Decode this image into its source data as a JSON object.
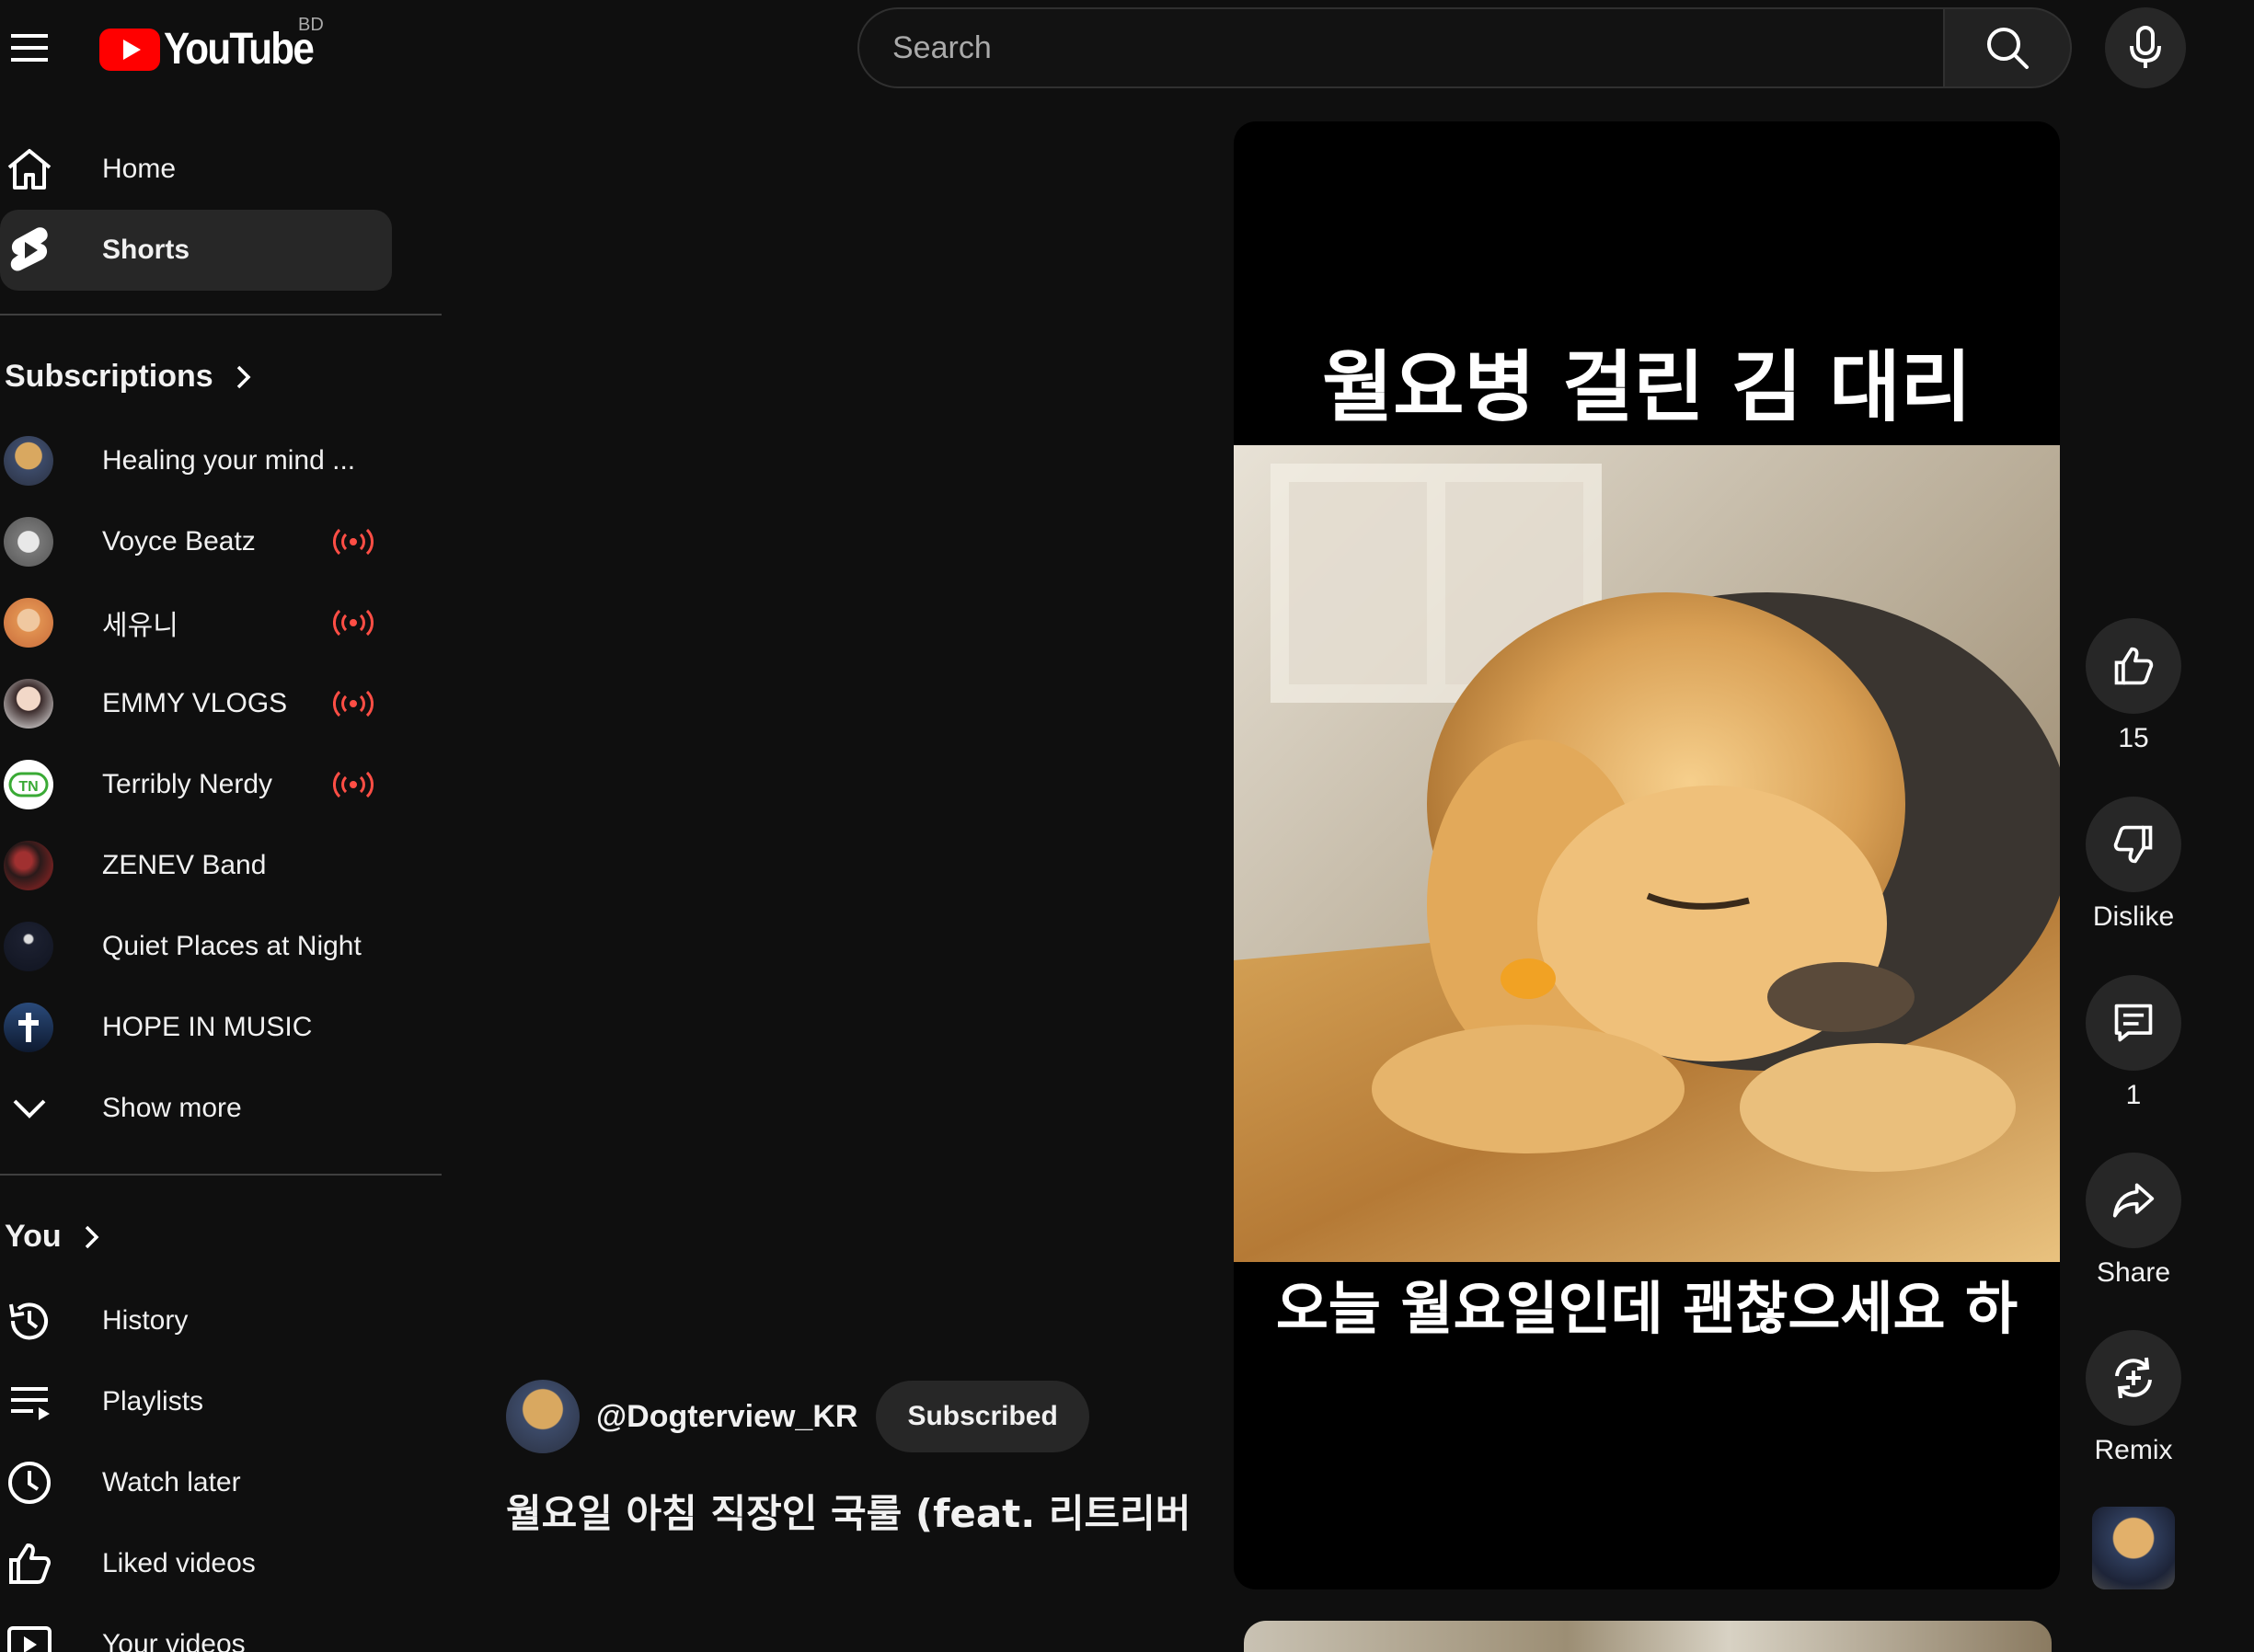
{
  "header": {
    "logo_text": "YouTube",
    "country_code": "BD",
    "search_placeholder": "Search"
  },
  "sidebar": {
    "primary": [
      {
        "label": "Home"
      },
      {
        "label": "Shorts"
      }
    ],
    "subscriptions_title": "Subscriptions",
    "subscriptions": [
      {
        "label": "Healing your mind ...",
        "live": false
      },
      {
        "label": "Voyce Beatz",
        "live": true
      },
      {
        "label": "세유니",
        "live": true
      },
      {
        "label": "EMMY VLOGS",
        "live": true
      },
      {
        "label": "Terribly Nerdy",
        "live": true
      },
      {
        "label": "ZENEV Band",
        "live": false
      },
      {
        "label": "Quiet Places at Night",
        "live": false
      },
      {
        "label": "HOPE IN MUSIC",
        "live": false
      }
    ],
    "show_more": "Show more",
    "you_title": "You",
    "you_items": [
      {
        "label": "History"
      },
      {
        "label": "Playlists"
      },
      {
        "label": "Watch later"
      },
      {
        "label": "Liked videos"
      },
      {
        "label": "Your videos"
      }
    ]
  },
  "short": {
    "overlay_top": "월요병 걸린 김 대리",
    "overlay_bottom": "오늘 월요일인데 괜찮으세요 하",
    "channel_handle": "@Dogterview_KR",
    "subscribe_label": "Subscribed",
    "title": "월요일 아침 직장인 국룰 (feat. 리트리버 ..."
  },
  "actions": {
    "like_count": "15",
    "dislike_label": "Dislike",
    "comment_count": "1",
    "share_label": "Share",
    "remix_label": "Remix"
  },
  "colors": {
    "background": "#0f0f0f",
    "youtube_red": "#ff0000",
    "live_red": "#ff4e45",
    "chip": "#272727"
  }
}
